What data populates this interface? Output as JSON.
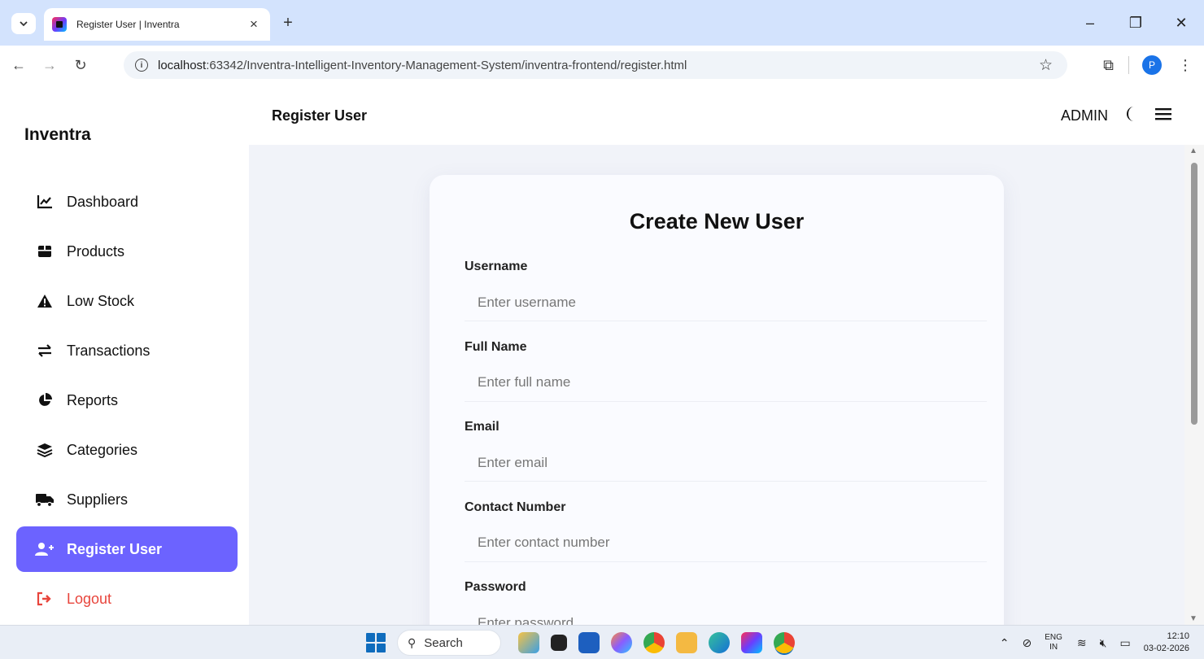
{
  "browser": {
    "tab_title": "Register User | Inventra",
    "tab_close": "×",
    "new_tab": "+",
    "url_host": "localhost",
    "url_rest": ":63342/Inventra-Intelligent-Inventory-Management-System/inventra-frontend/register.html",
    "profile_initial": "P",
    "window_controls": {
      "minimize": "–",
      "restore": "❐",
      "close": "✕"
    }
  },
  "sidebar": {
    "brand": "Inventra",
    "items": [
      {
        "label": "Dashboard",
        "icon": "chart-line-icon"
      },
      {
        "label": "Products",
        "icon": "box-icon"
      },
      {
        "label": "Low Stock",
        "icon": "warning-icon"
      },
      {
        "label": "Transactions",
        "icon": "exchange-icon"
      },
      {
        "label": "Reports",
        "icon": "pie-chart-icon"
      },
      {
        "label": "Categories",
        "icon": "layers-icon"
      },
      {
        "label": "Suppliers",
        "icon": "truck-icon"
      },
      {
        "label": "Register User",
        "icon": "user-plus-icon",
        "active": true
      },
      {
        "label": "Logout",
        "icon": "logout-icon"
      }
    ]
  },
  "header": {
    "title": "Register User",
    "role": "ADMIN"
  },
  "form": {
    "title": "Create New User",
    "fields": [
      {
        "label": "Username",
        "placeholder": "Enter username"
      },
      {
        "label": "Full Name",
        "placeholder": "Enter full name"
      },
      {
        "label": "Email",
        "placeholder": "Enter email"
      },
      {
        "label": "Contact Number",
        "placeholder": "Enter contact number"
      },
      {
        "label": "Password",
        "placeholder": "Enter password"
      }
    ]
  },
  "taskbar": {
    "search": "Search",
    "lang_top": "ENG",
    "lang_bottom": "IN",
    "time": "12:10",
    "date": "03-02-2026"
  },
  "colors": {
    "accent": "#6c63ff",
    "logout": "#e8453c"
  }
}
